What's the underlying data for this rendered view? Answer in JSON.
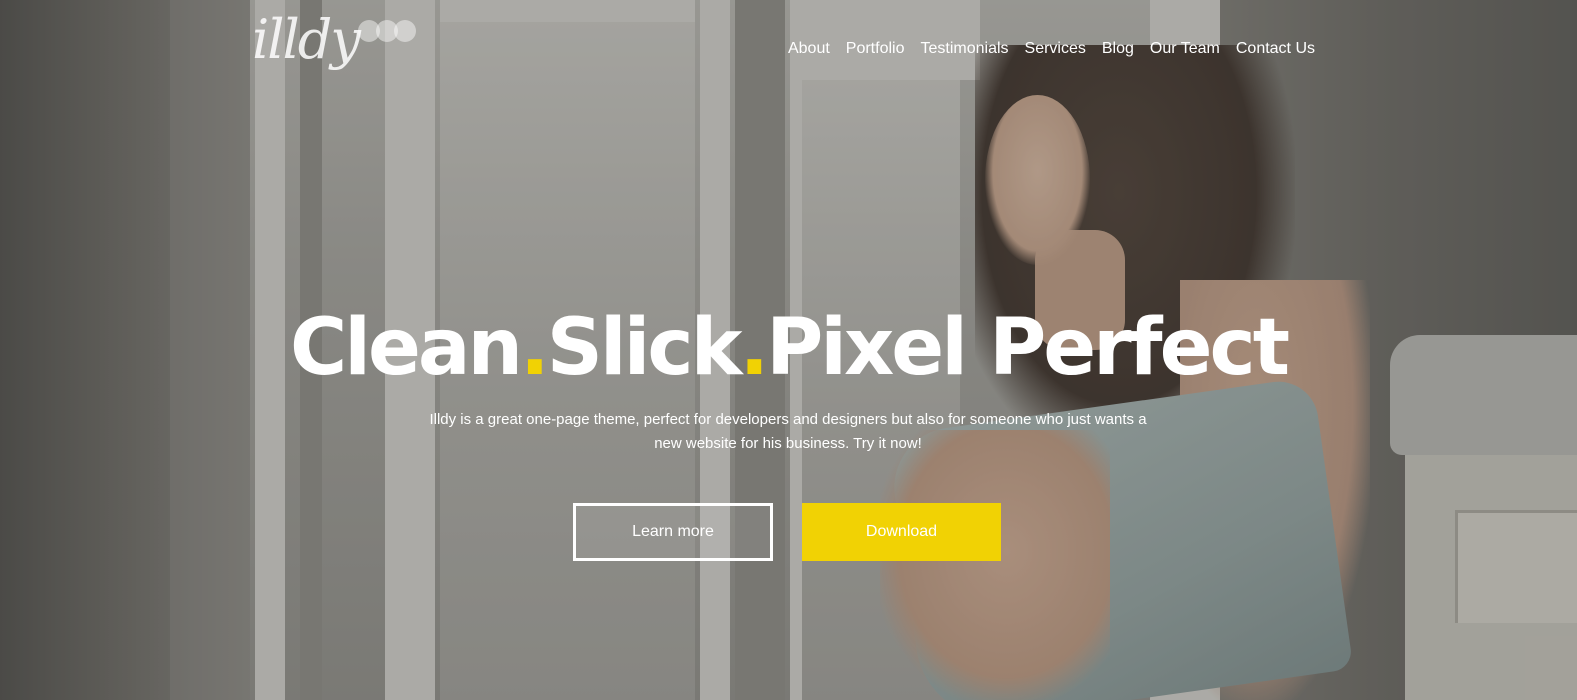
{
  "logo": {
    "text": "illdy"
  },
  "nav": {
    "items": [
      "About",
      "Portfolio",
      "Testimonials",
      "Services",
      "Blog",
      "Our Team",
      "Contact Us"
    ]
  },
  "hero": {
    "headline": {
      "word1": "Clean",
      "sep1": ".",
      "word2": "Slick",
      "sep2": ".",
      "word3": "Pixel Perfect"
    },
    "subtitle_line1": "Illdy is a great one-page theme, perfect for developers and designers but also for someone who just wants a",
    "subtitle_line2": "new website for his business. Try it now!",
    "learn_more_label": "Learn more",
    "download_label": "Download"
  },
  "colors": {
    "accent": "#f1d204",
    "text": "#ffffff"
  }
}
